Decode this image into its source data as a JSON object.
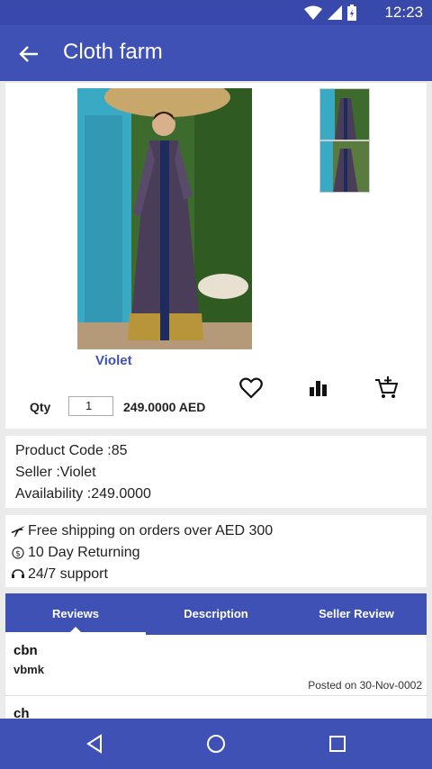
{
  "status": {
    "time": "12:23"
  },
  "appbar": {
    "title": "Cloth farm"
  },
  "product": {
    "variant": "Violet",
    "qty_label": "Qty",
    "qty_value": "1",
    "price": "249.0000 AED"
  },
  "info": {
    "product_code": "Product Code :85",
    "seller": "Seller :Violet",
    "availability": "Availability :249.0000"
  },
  "shipping": {
    "free_shipping": "Free shipping on orders over AED 300",
    "returning": "10 Day Returning",
    "support": "24/7 support"
  },
  "tabs": [
    {
      "label": "Reviews"
    },
    {
      "label": "Description"
    },
    {
      "label": "Seller Review"
    }
  ],
  "reviews": [
    {
      "name": "cbn",
      "text": "vbmk",
      "date": "Posted on 30-Nov-0002"
    },
    {
      "name": "ch",
      "text": "",
      "date": ""
    }
  ],
  "colors": {
    "primary": "#3f51b5",
    "status_bar": "#3949ab",
    "accent_text": "#3f51b5"
  }
}
